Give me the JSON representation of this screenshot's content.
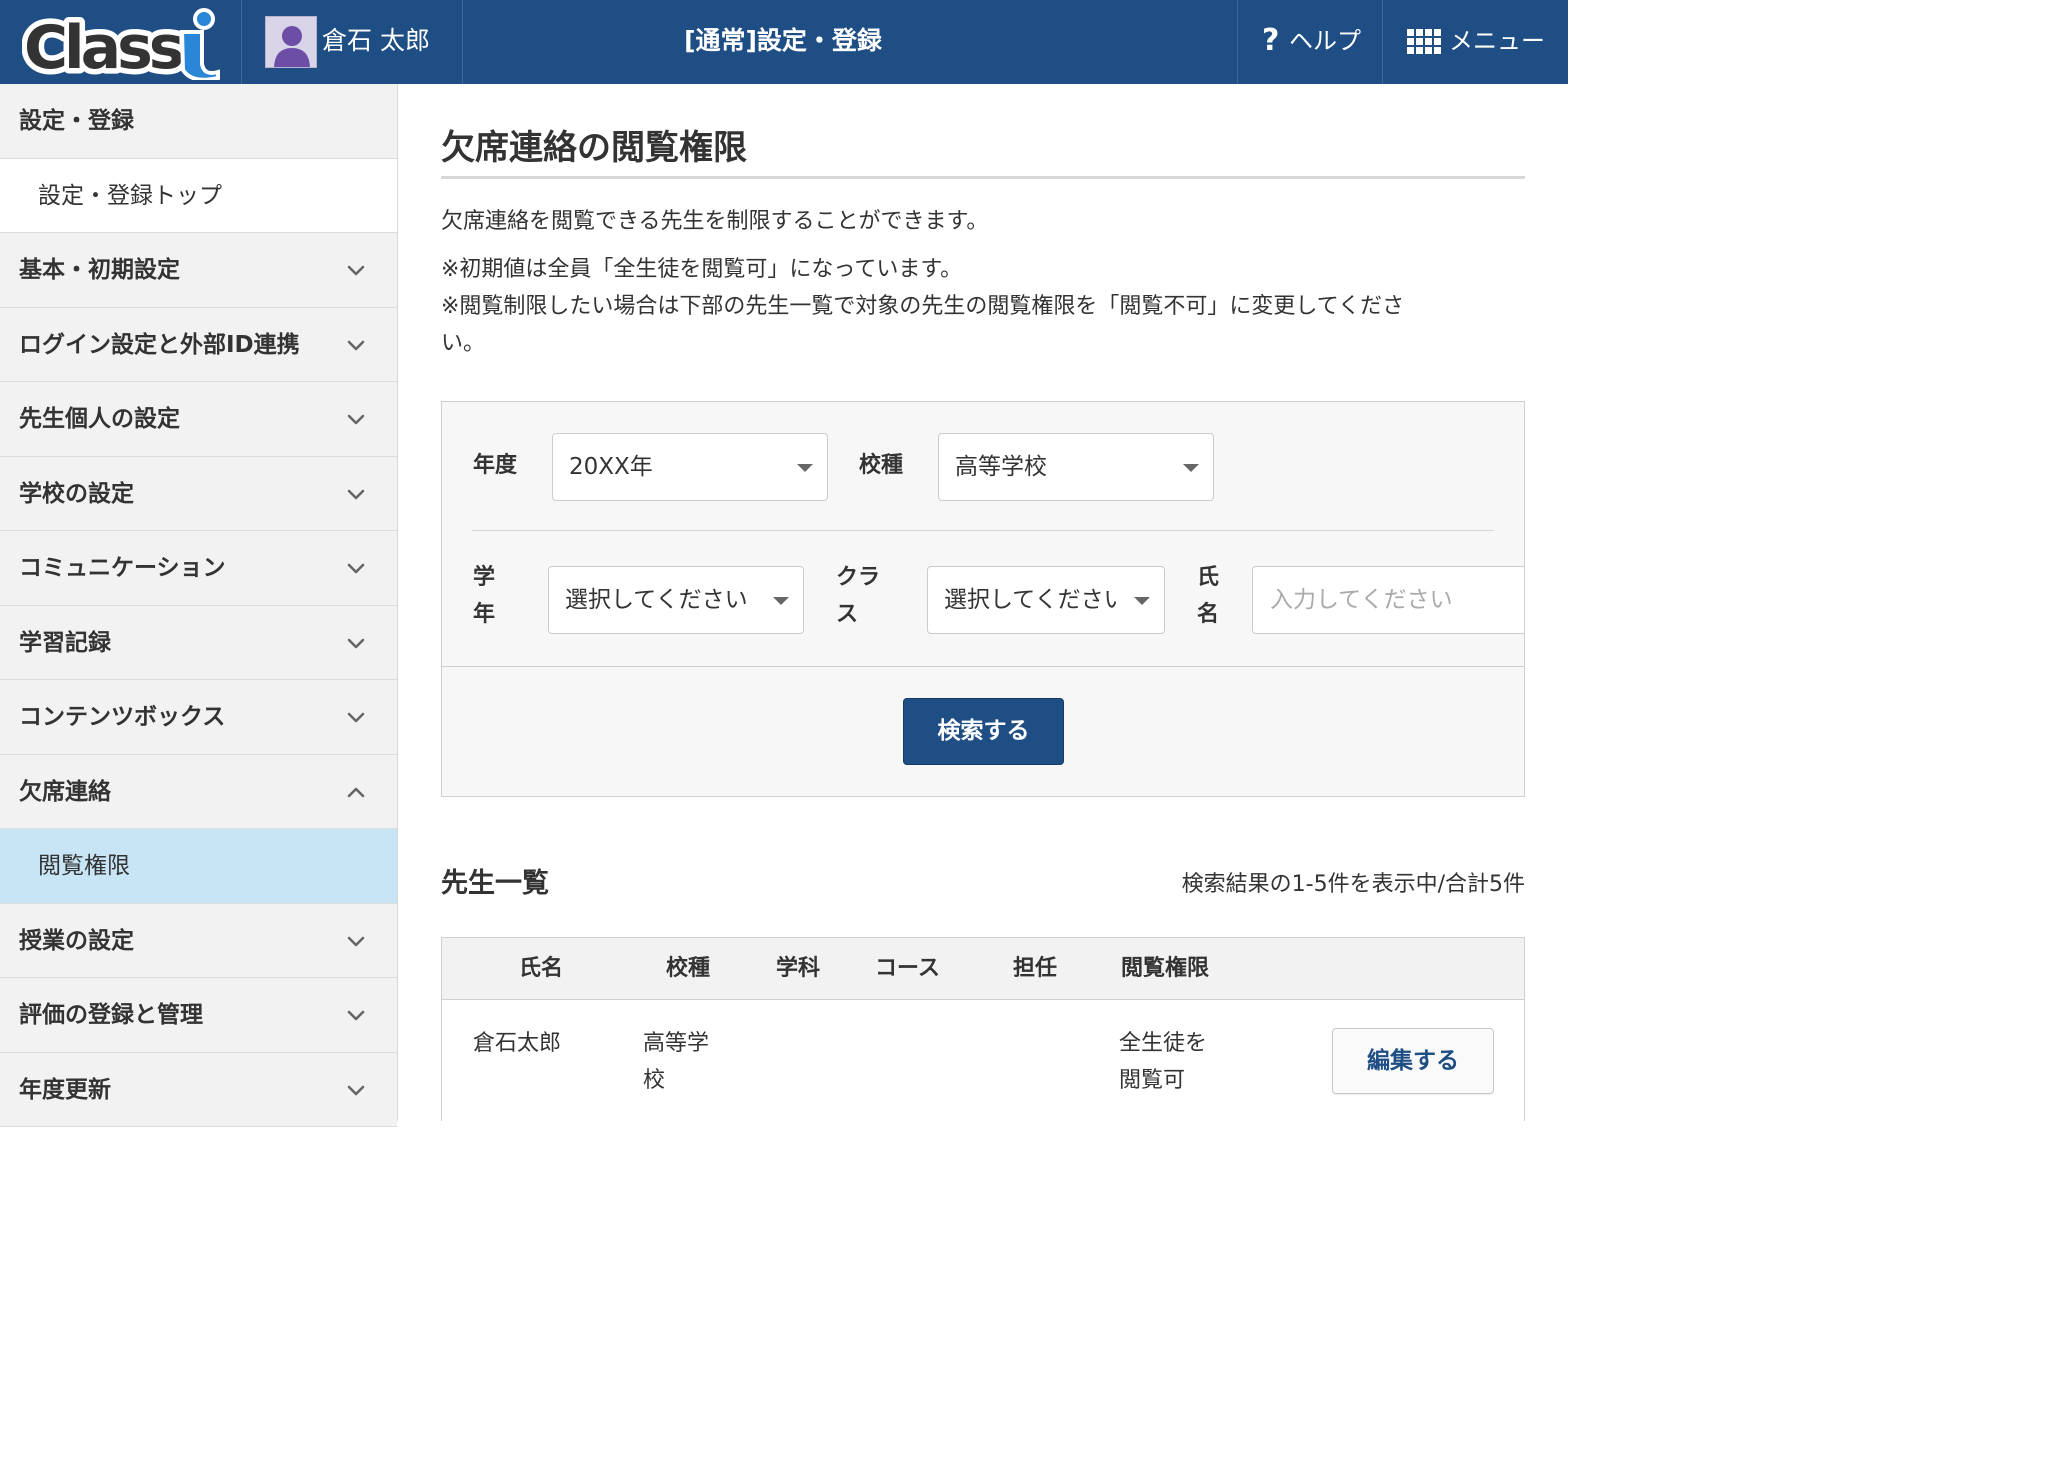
{
  "header": {
    "logo_text": "Classi",
    "user_name": "倉石 太郎",
    "title": "[通常]設定・登録",
    "help_label": "ヘルプ",
    "help_icon": "question-mark-icon",
    "menu_label": "メニュー",
    "menu_icon": "grid-icon",
    "colors": {
      "header_bg": "#1f4e85",
      "accent": "#1f4e85",
      "active_nav_bg": "#c8e5f6"
    }
  },
  "sidebar": {
    "heading": "設定・登録",
    "items": [
      {
        "label": "設定・登録トップ",
        "type": "sub"
      },
      {
        "label": "基本・初期設定",
        "chevron": "down"
      },
      {
        "label": "ログイン設定と外部ID連携",
        "chevron": "down"
      },
      {
        "label": "先生個人の設定",
        "chevron": "down"
      },
      {
        "label": "学校の設定",
        "chevron": "down"
      },
      {
        "label": "コミュニケーション",
        "chevron": "down"
      },
      {
        "label": "学習記録",
        "chevron": "down"
      },
      {
        "label": "コンテンツボックス",
        "chevron": "down"
      },
      {
        "label": "欠席連絡",
        "chevron": "up"
      },
      {
        "label": "閲覧権限",
        "type": "sub",
        "active": true
      },
      {
        "label": "授業の設定",
        "chevron": "down"
      },
      {
        "label": "評価の登録と管理",
        "chevron": "down"
      },
      {
        "label": "年度更新",
        "chevron": "down"
      }
    ]
  },
  "main": {
    "title": "欠席連絡の閲覧権限",
    "description": [
      "欠席連絡を閲覧できる先生を制限することができます。",
      "※初期値は全員「全生徒を閲覧可」になっています。",
      "※閲覧制限したい場合は下部の先生一覧で対象の先生の閲覧権限を「閲覧不可」に変更してくださ",
      "い。"
    ],
    "filters": {
      "year_label": "年度",
      "year_value": "20XX年",
      "school_type_label": "校種",
      "school_type_value": "高等学校",
      "grade_label": [
        "学",
        "年"
      ],
      "grade_value": "選択してください",
      "class_label": [
        "クラ",
        "ス"
      ],
      "class_value": "選択してください",
      "name_label": [
        "氏",
        "名"
      ],
      "name_placeholder": "入力してください",
      "search_button": "検索する"
    },
    "list": {
      "title": "先生一覧",
      "count_text": "検索結果の1-5件を表示中/合計5件",
      "columns": [
        "氏名",
        "校種",
        "学科",
        "コース",
        "担任",
        "閲覧権限"
      ],
      "rows": [
        {
          "name": "倉石太郎",
          "school_type": [
            "高等学",
            "校"
          ],
          "department": "",
          "course": "",
          "homeroom": "",
          "permission": [
            "全生徒を",
            "閲覧可"
          ],
          "action": "編集する"
        }
      ]
    }
  }
}
